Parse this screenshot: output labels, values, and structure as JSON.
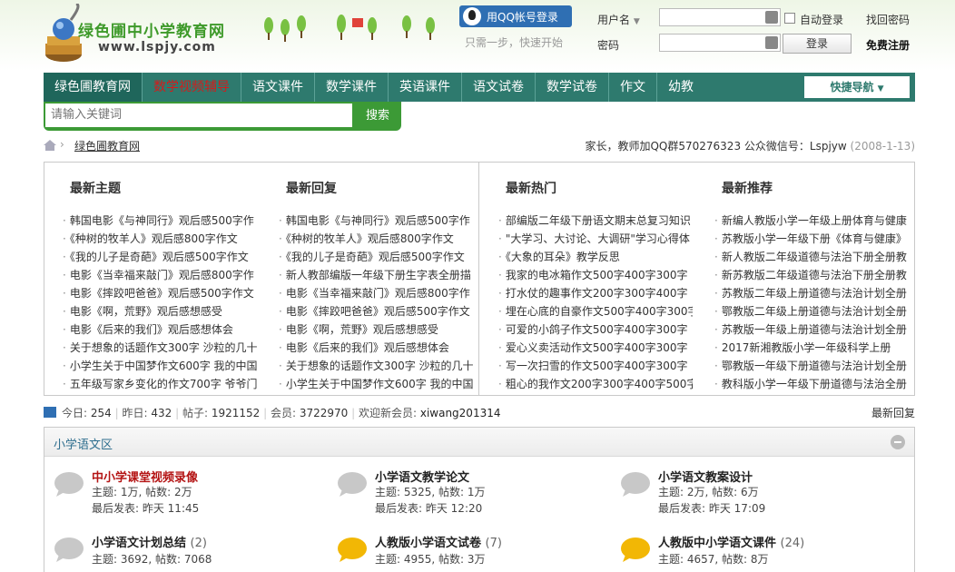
{
  "header": {
    "site_name": "绿色圃中小学教育网",
    "site_url": "www.lspjy.com",
    "qq_login": "用QQ帐号登录",
    "qq_tip": "只需一步，快速开始",
    "username_label": "用户名",
    "password_label": "密码",
    "auto_login": "自动登录",
    "find_password": "找回密码",
    "login_button": "登录",
    "register": "免费注册"
  },
  "nav": {
    "items": [
      "绿色圃教育网",
      "数学视频辅导",
      "语文课件",
      "数学课件",
      "英语课件",
      "语文试卷",
      "数学试卷",
      "作文",
      "幼教"
    ],
    "quick_nav": "快捷导航"
  },
  "search": {
    "placeholder": "请输入关键词",
    "button": "搜索"
  },
  "breadcrumb": {
    "separator": "›",
    "link": "绿色圃教育网",
    "notice": "家长，教师加QQ群570276323 公众微信号：Lspjyw",
    "date": "(2008-1-13)"
  },
  "lists": [
    {
      "title": "最新主题",
      "items": [
        "韩国电影《与神同行》观后感500字作",
        "《种树的牧羊人》观后感800字作文",
        "《我的儿子是奇葩》观后感500字作文",
        "电影《当幸福来敲门》观后感800字作",
        "电影《摔跤吧爸爸》观后感500字作文",
        "电影《啊，荒野》观后感想感受",
        "电影《后来的我们》观后感想体会",
        "关于想象的话题作文300字 沙粒的几十",
        "小学生关于中国梦作文600字 我的中国",
        "五年级写家乡变化的作文700字 爷爷门"
      ]
    },
    {
      "title": "最新回复",
      "items": [
        "韩国电影《与神同行》观后感500字作",
        "《种树的牧羊人》观后感800字作文",
        "《我的儿子是奇葩》观后感500字作文",
        "新人教部编版一年级下册生字表全册描",
        "电影《当幸福来敲门》观后感800字作",
        "电影《摔跤吧爸爸》观后感500字作文",
        "电影《啊，荒野》观后感想感受",
        "电影《后来的我们》观后感想体会",
        "关于想象的话题作文300字 沙粒的几十",
        "小学生关于中国梦作文600字 我的中国"
      ]
    },
    {
      "title": "最新热门",
      "items": [
        "部编版二年级下册语文期末总复习知识",
        "\"大学习、大讨论、大调研\"学习心得体",
        "《大象的耳朵》教学反思",
        "我家的电冰箱作文500字400字300字",
        "打水仗的趣事作文200字300字400字",
        "埋在心底的自豪作文500字400字300字",
        "可爱的小鸽子作文500字400字300字",
        "爱心义卖活动作文500字400字300字",
        "写一次扫雪的作文500字400字300字",
        "粗心的我作文200字300字400字500字"
      ]
    },
    {
      "title": "最新推荐",
      "items": [
        "新编人教版小学一年级上册体育与健康",
        "苏教版小学一年级下册《体育与健康》",
        "新人教版二年级道德与法治下册全册教",
        "新苏教版二年级道德与法治下册全册教",
        "苏教版二年级上册道德与法治计划全册",
        "鄂教版二年级上册道德与法治计划全册",
        "苏教版一年级上册道德与法治计划全册",
        "2017新湘教版小学一年级科学上册",
        "鄂教版一年级下册道德与法治计划全册",
        "教科版小学一年级下册道德与法治全册"
      ]
    }
  ],
  "stats": {
    "today_label": "今日:",
    "today": "254",
    "yesterday_label": "昨日:",
    "yesterday": "432",
    "posts_label": "帖子:",
    "posts": "1921152",
    "members_label": "会员:",
    "members": "3722970",
    "newest_label": "欢迎新会员:",
    "newest": "xiwang201314",
    "latest_reply": "最新回复"
  },
  "forum": {
    "section_title": "小学语文区",
    "boards": [
      {
        "name": "中小学课堂视频录像",
        "new": "",
        "topics_line": "主题: 1万, 帖数: 2万",
        "last_line": "最后发表: 昨天 11:45",
        "highlight": true,
        "active": false
      },
      {
        "name": "小学语文教学论文",
        "new": "",
        "topics_line": "主题: 5325, 帖数: 1万",
        "last_line": "最后发表: 昨天 12:20",
        "highlight": false,
        "active": false
      },
      {
        "name": "小学语文教案设计",
        "new": "",
        "topics_line": "主题: 2万, 帖数: 6万",
        "last_line": "最后发表: 昨天 17:09",
        "highlight": false,
        "active": false
      },
      {
        "name": "小学语文计划总结",
        "new": "(2)",
        "topics_line": "主题: 3692, 帖数: 7068",
        "last_line": "",
        "highlight": false,
        "active": false
      },
      {
        "name": "人教版小学语文试卷",
        "new": "(7)",
        "topics_line": "主题: 4955, 帖数: 3万",
        "last_line": "",
        "highlight": false,
        "active": true
      },
      {
        "name": "人教版中小学语文课件",
        "new": "(24)",
        "topics_line": "主题: 4657, 帖数: 8万",
        "last_line": "",
        "highlight": false,
        "active": true
      }
    ]
  },
  "colors": {
    "nav_bg": "#2e7a6e",
    "search_bg": "#3c9a36",
    "hot_red": "#d41b1b",
    "qq_blue": "#2f6fb3"
  }
}
